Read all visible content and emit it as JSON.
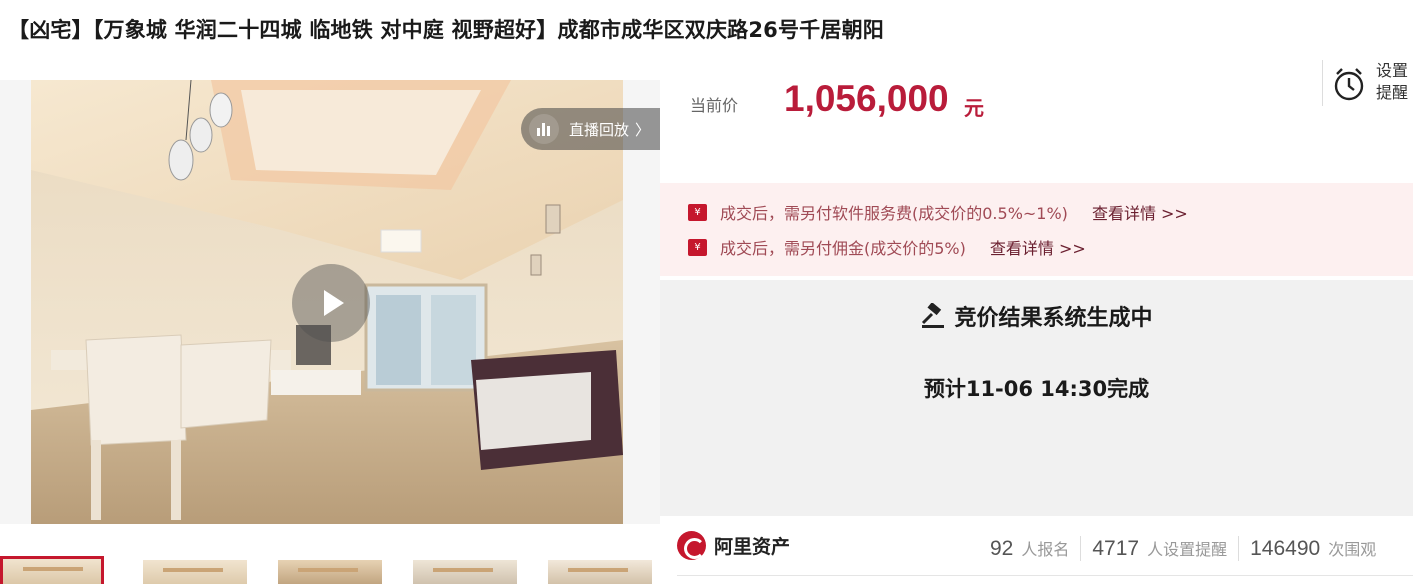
{
  "listing": {
    "title": "【凶宅】【万象城 华润二十四城 临地铁 对中庭 视野超好】成都市成华区双庆路26号千居朝阳"
  },
  "media": {
    "live_replay_label": "直播回放",
    "live_replay_arrow": "〉",
    "play_icon": "play-icon",
    "thumbnails": [
      "thumb-1",
      "thumb-2",
      "thumb-3",
      "thumb-4",
      "thumb-5"
    ]
  },
  "price": {
    "label": "当前价",
    "value": "1,056,000",
    "unit": "元",
    "color": "#b91c3a"
  },
  "reminder": {
    "label": "设置提醒",
    "icon": "alarm-clock-icon"
  },
  "notices": [
    {
      "icon": "yen-icon",
      "text": "成交后，需另付软件服务费(成交价的0.5%~1%)",
      "link": "查看详情 >>"
    },
    {
      "icon": "yen-icon",
      "text": "成交后，需另付佣金(成交价的5%)",
      "link": "查看详情 >>"
    }
  ],
  "result": {
    "icon": "gavel-icon",
    "heading": "竞价结果系统生成中",
    "eta": "预计11-06 14:30完成"
  },
  "brand": {
    "name": "阿里资产",
    "logo_color": "#c5172d"
  },
  "stats": [
    {
      "value": "92",
      "label": "人报名"
    },
    {
      "value": "4717",
      "label": "人设置提醒"
    },
    {
      "value": "146490",
      "label": "次围观"
    }
  ]
}
